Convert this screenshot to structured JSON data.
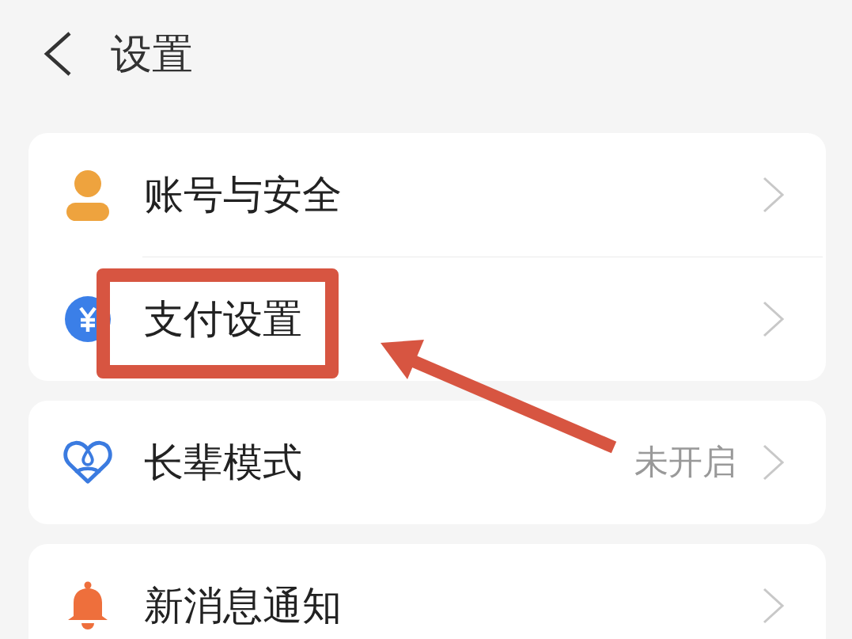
{
  "header": {
    "title": "设置"
  },
  "groups": [
    {
      "items": [
        {
          "label": "账号与安全",
          "highlighted": false
        },
        {
          "label": "支付设置",
          "highlighted": true
        }
      ]
    },
    {
      "items": [
        {
          "label": "长辈模式",
          "value": "未开启",
          "highlighted": false
        }
      ]
    },
    {
      "items": [
        {
          "label": "新消息通知",
          "highlighted": false
        }
      ]
    }
  ]
}
